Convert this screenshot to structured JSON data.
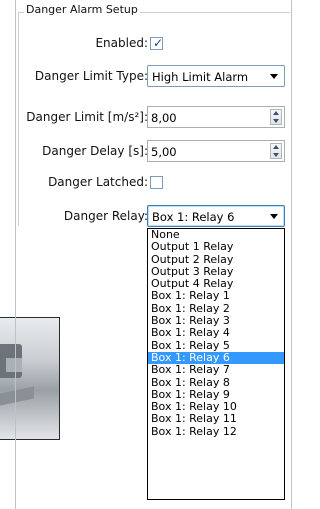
{
  "group": {
    "title": "Danger Alarm Setup"
  },
  "fields": {
    "enabled": {
      "label": "Enabled:",
      "checked": true
    },
    "limit_type": {
      "label": "Danger Limit Type:",
      "value": "High Limit Alarm"
    },
    "limit": {
      "label": "Danger Limit [m/s²]:",
      "value": "8,00"
    },
    "delay": {
      "label": "Danger Delay [s]:",
      "value": "5,00"
    },
    "latched": {
      "label": "Danger Latched:",
      "checked": false
    },
    "relay": {
      "label": "Danger Relay:",
      "value": "Box 1: Relay 6"
    }
  },
  "relay_options": [
    "None",
    "Output 1 Relay",
    "Output 2 Relay",
    "Output 3 Relay",
    "Output 4 Relay",
    "Box 1: Relay 1",
    "Box 1: Relay 2",
    "Box 1: Relay 3",
    "Box 1: Relay 4",
    "Box 1: Relay 5",
    "Box 1: Relay 6",
    "Box 1: Relay 7",
    "Box 1: Relay 8",
    "Box 1: Relay 9",
    "Box 1: Relay 10",
    "Box 1: Relay 11",
    "Box 1: Relay 12"
  ],
  "selected_relay": "Box 1: Relay 6",
  "colors": {
    "selection": "#3399ff",
    "accent": "#1b3f8b"
  },
  "icons": {
    "check": "checkmark-icon",
    "dropdown": "chevron-down-icon",
    "spinner": "spinner-arrows-icon"
  }
}
